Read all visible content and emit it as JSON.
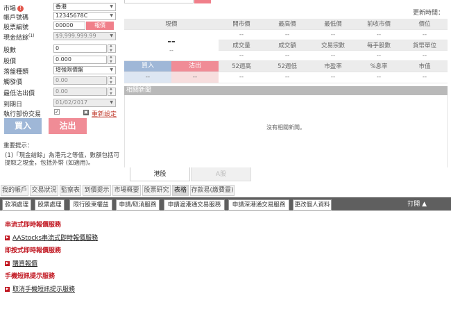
{
  "form": {
    "market_label": "市場",
    "market_value": "香港",
    "account_label": "帳戶號碼",
    "account_value": "12345678C",
    "stock_label": "股票編號",
    "stock_value": "00000",
    "quote_button": "報價",
    "cash_label": "現金結餘",
    "cash_sup": "(1)",
    "cash_value": "$9,999,999.99",
    "qty_label": "股數",
    "qty_value": "0",
    "price_label": "股價",
    "price_value": "0.000",
    "order_type_label": "落盤種類",
    "order_type_value": "增強限價盤",
    "trigger_label": "觸發價",
    "trigger_value": "0.00",
    "lowest_sell_label": "最低沽出價",
    "lowest_sell_value": "0.00",
    "expiry_label": "到期日",
    "expiry_value": "01/02/2017",
    "partial_label": "執行部份交易",
    "partial_check": "✓",
    "reset_link": "重新設定",
    "buy_button": "買入",
    "sell_button": "沽出",
    "notes_title": "重要提示：",
    "note_1": "(1)「現金結餘」為港元之等值，數額包括可提取之現金，包括外幣 (如適用)。"
  },
  "quote": {
    "update_time_label": "更新時間：",
    "col_headers": [
      "現價",
      "開市價",
      "最高價",
      "最低價",
      "前收市價",
      "價位"
    ],
    "row1_values": [
      "--",
      "--",
      "--",
      "--",
      "--"
    ],
    "price_display": "--",
    "price_change": "--",
    "sub_headers_1": [
      "成交量",
      "成交額",
      "交易宗數",
      "每手股數",
      "貨幣單位"
    ],
    "row2_values": [
      "--",
      "--",
      "--",
      "--",
      "--"
    ],
    "buy_label": "買入",
    "sell_label": "沽出",
    "sub_headers_2": [
      "52週高",
      "52週低",
      "市盈率",
      "%息率",
      "市值"
    ],
    "buy_value": "--",
    "sell_value": "--",
    "row3_values": [
      "--",
      "--",
      "--",
      "--",
      "--"
    ],
    "news_header": "相關新聞",
    "no_news": "沒有相關新聞。",
    "market_tab_active": "港股",
    "market_tab_inactive": "A股"
  },
  "nav1": [
    "我的帳戶",
    "交易狀況",
    "監察表",
    "到價提示",
    "市場概要",
    "股票研究",
    "表格",
    "存款易(繳費靈)"
  ],
  "nav2": [
    "款項處理",
    "股票處理",
    "限行股東權益",
    "申請/取消服務",
    "申請滬港通交易服務",
    "申請深港通交易服務",
    "更改個人資料"
  ],
  "print_label": "打開 ▲",
  "services": {
    "section1": "串流式即時報價服務",
    "link1": "AAStocks串流式即時報價服務",
    "section2": "即按式即時報價服務",
    "link2": "購買報價",
    "section3": "手機短訊提示服務",
    "link3": "取消手機短訊提示服務"
  },
  "colors": {
    "accent_red": "#c0141e",
    "buy_blue": "#9fb7d7",
    "sell_pink": "#f08c96",
    "nav_dark": "#5f5f5f"
  }
}
